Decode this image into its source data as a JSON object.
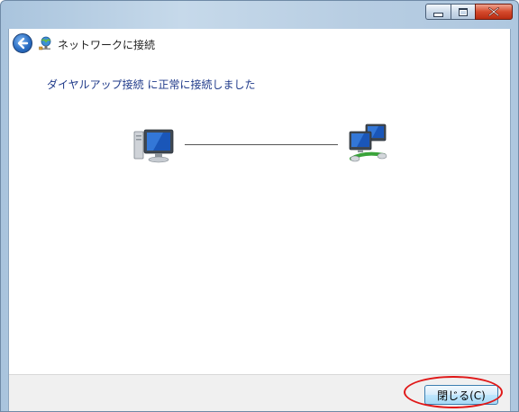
{
  "window": {
    "title": "ネットワークに接続",
    "caption_buttons": [
      "minimize",
      "maximize",
      "close"
    ]
  },
  "content": {
    "heading": "ダイヤルアップ接続 に正常に接続しました",
    "icons": {
      "left": "computer-icon",
      "right": "network-connection-icon",
      "back": "back-arrow-icon",
      "title": "network-icon"
    }
  },
  "footer": {
    "close_label": "閉じる(C)"
  },
  "colors": {
    "heading_text": "#1f3a8a",
    "highlight": "#e01818",
    "close_caption": "#d54a2c"
  }
}
